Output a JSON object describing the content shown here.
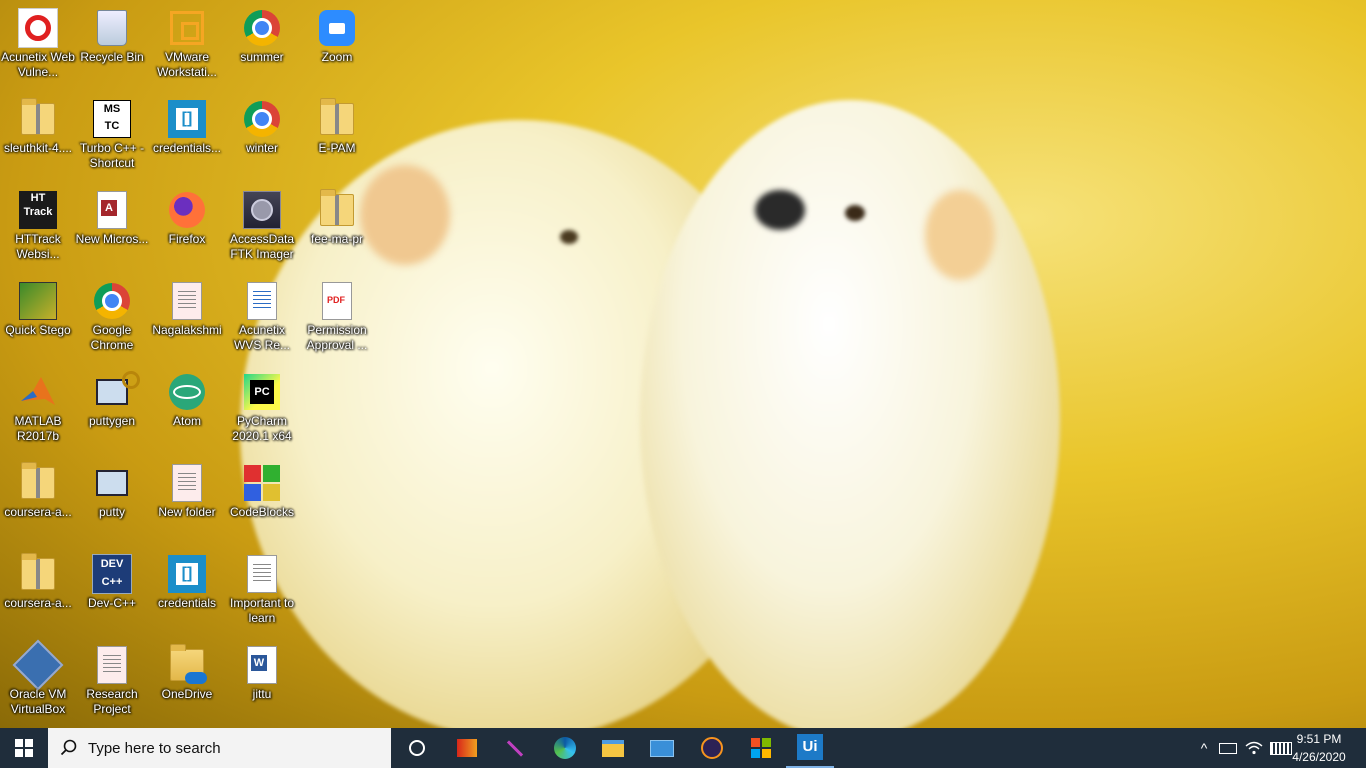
{
  "taskbar": {
    "search_placeholder": "Type here to search",
    "time": "9:51 PM",
    "date": "4/26/2020"
  },
  "desktop": {
    "wallpaper": "two white puppies on yellow flowers",
    "icons": {
      "acunetix": "Acunetix Web Vulne...",
      "recycle": "Recycle Bin",
      "vmware": "VMware Workstati...",
      "summer": "summer",
      "zoom": "Zoom",
      "sleuthkit": "sleuthkit-4....",
      "turbo": "Turbo C++ - Shortcut",
      "credentials1": "credentials...",
      "winter": "winter",
      "epam": "E-PAM",
      "httrack": "HTTrack Websi...",
      "newms": "New Micros...",
      "firefox": "Firefox",
      "ftk": "AccessData FTK Imager",
      "fee": "fee-ma-pr",
      "quickstego": "Quick Stego",
      "chrome": "Google Chrome",
      "nagalakshmi": "Nagalakshmi",
      "acunetixwvs": "Acunetix WVS Re...",
      "permission": "Permission Approval ...",
      "matlab": "MATLAB R2017b",
      "puttygen": "puttygen",
      "atom": "Atom",
      "pycharm": "PyCharm 2020.1 x64",
      "coursera1": "coursera-a...",
      "putty": "putty",
      "newfolder": "New folder",
      "codeblocks": "CodeBlocks",
      "coursera2": "coursera-a...",
      "devcpp": "Dev-C++",
      "credentials2": "credentials",
      "important": "Important to learn",
      "virtualbox": "Oracle VM VirtualBox",
      "research": "Research Project",
      "onedrive": "OneDrive",
      "jittu": "jittu"
    }
  },
  "colors": {
    "taskbar_bg": "#1f2d3b",
    "accent": "#7fb2e6"
  }
}
